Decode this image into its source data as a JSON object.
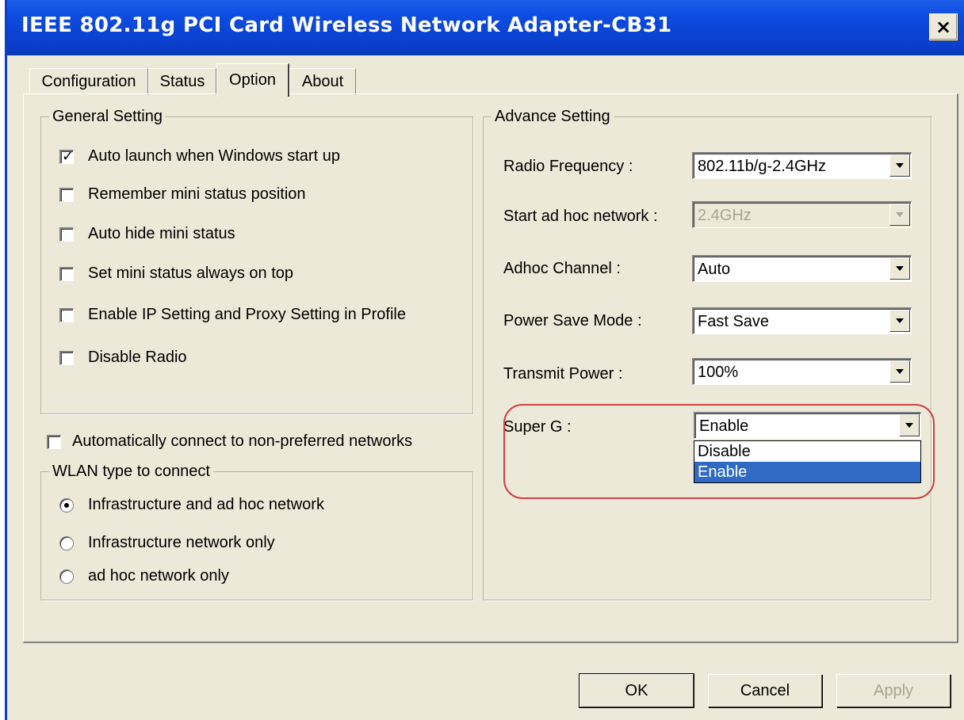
{
  "window": {
    "title": "IEEE 802.11g  PCI Card  Wireless  Network  Adapter-CB31",
    "close_glyph": "×"
  },
  "tabs": [
    {
      "label": "Configuration",
      "active": false
    },
    {
      "label": "Status",
      "active": false
    },
    {
      "label": "Option",
      "active": true
    },
    {
      "label": "About",
      "active": false
    }
  ],
  "general_setting": {
    "legend": "General Setting",
    "items": [
      {
        "label": "Auto launch when Windows start up",
        "checked": true
      },
      {
        "label": "Remember mini status position",
        "checked": false
      },
      {
        "label": "Auto hide mini status",
        "checked": false
      },
      {
        "label": "Set mini status always on top",
        "checked": false
      },
      {
        "label": "Enable IP Setting and Proxy Setting in Profile",
        "checked": false
      },
      {
        "label": "Disable Radio",
        "checked": false
      }
    ]
  },
  "auto_connect": {
    "label": "Automatically connect to non-preferred networks",
    "checked": false
  },
  "wlan_type": {
    "legend": "WLAN type to connect",
    "options": [
      {
        "label": "Infrastructure and ad hoc network",
        "selected": true
      },
      {
        "label": "Infrastructure network only",
        "selected": false
      },
      {
        "label": "ad hoc network only",
        "selected": false
      }
    ]
  },
  "advance_setting": {
    "legend": "Advance Setting",
    "fields": [
      {
        "label": "Radio Frequency :",
        "value": "802.11b/g-2.4GHz",
        "disabled": false
      },
      {
        "label": "Start ad hoc network :",
        "value": "2.4GHz",
        "disabled": true
      },
      {
        "label": "Adhoc Channel :",
        "value": "Auto",
        "disabled": false
      },
      {
        "label": "Power Save Mode :",
        "value": "Fast Save",
        "disabled": false
      },
      {
        "label": "Transmit Power :",
        "value": "100%",
        "disabled": false
      },
      {
        "label": "Super G :",
        "value": "Enable",
        "disabled": false
      }
    ],
    "super_g_options": [
      {
        "label": "Disable",
        "selected": false
      },
      {
        "label": "Enable",
        "selected": true
      }
    ]
  },
  "buttons": {
    "ok": "OK",
    "cancel": "Cancel",
    "apply": "Apply"
  },
  "colors": {
    "titlebar": "#0a3fcc",
    "dialog_face": "#ece9d8",
    "selection": "#316ac5",
    "highlight_oval": "#d04040"
  }
}
